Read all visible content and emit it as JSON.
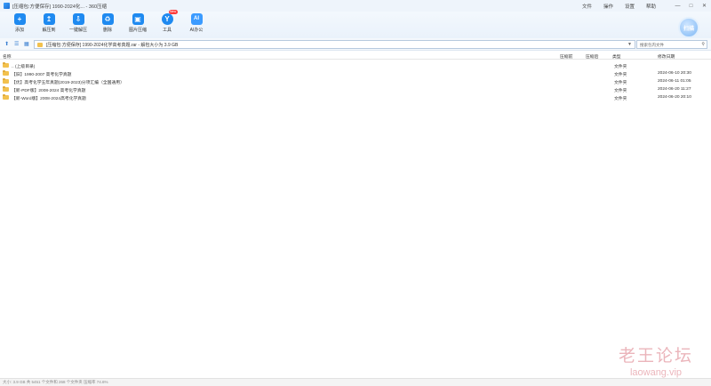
{
  "window": {
    "title": "[压缩包:方便保存] 1990-2024化... - 360压缩",
    "menu": [
      "文件",
      "操作",
      "设置",
      "帮助"
    ],
    "controls": [
      "—",
      "□",
      "✕"
    ]
  },
  "toolbar": {
    "buttons": [
      {
        "label": "添加",
        "icon": "add-icon",
        "color": "#1f8af0"
      },
      {
        "label": "解压到",
        "icon": "extract-to-icon",
        "color": "#1f8af0"
      },
      {
        "label": "一键解压",
        "icon": "one-click-extract-icon",
        "color": "#1f8af0"
      },
      {
        "label": "删除",
        "icon": "delete-icon",
        "color": "#1f8af0"
      },
      {
        "label": "图片压缩",
        "icon": "image-compress-icon",
        "color": "#1f8af0"
      },
      {
        "label": "工具",
        "icon": "tools-icon",
        "color": "#1f8af0",
        "badge": "New"
      },
      {
        "label": "AI办公",
        "icon": "ai-office-icon",
        "color": "#3b9bff"
      }
    ],
    "avatar_text": "扫描"
  },
  "path": {
    "text": "[压缩包:方便保存] 1990-2024化学高考真题.rar - 解包大小为 3.9 GB",
    "search_placeholder": "搜索包内文件"
  },
  "columns": [
    "名称",
    "压缩前",
    "压缩后",
    "类型",
    "修改日期"
  ],
  "rows": [
    {
      "name": ".. (上级目录)",
      "type": "文件夹",
      "date": ""
    },
    {
      "name": "【旧】1990-2007 高考化学真题",
      "type": "文件夹",
      "date": "2024-06-10 20:30"
    },
    {
      "name": "【优】高考化学五年真题(2019-2023)分项汇编（全国通用）",
      "type": "文件夹",
      "date": "2024-06-11 01:05"
    },
    {
      "name": "【新-PDF版】2008-2024 高考化学真题",
      "type": "文件夹",
      "date": "2024-06-20 11:27"
    },
    {
      "name": "【新-Word版】2008-2024高考化学真题",
      "type": "文件夹",
      "date": "2024-06-20 20:10"
    }
  ],
  "status": "大小: 3.9 GB 共 5451 个文件和 268 个文件夹 压缩率 74.6%",
  "watermark": {
    "cn": "老王论坛",
    "en": "laowang.vip"
  }
}
